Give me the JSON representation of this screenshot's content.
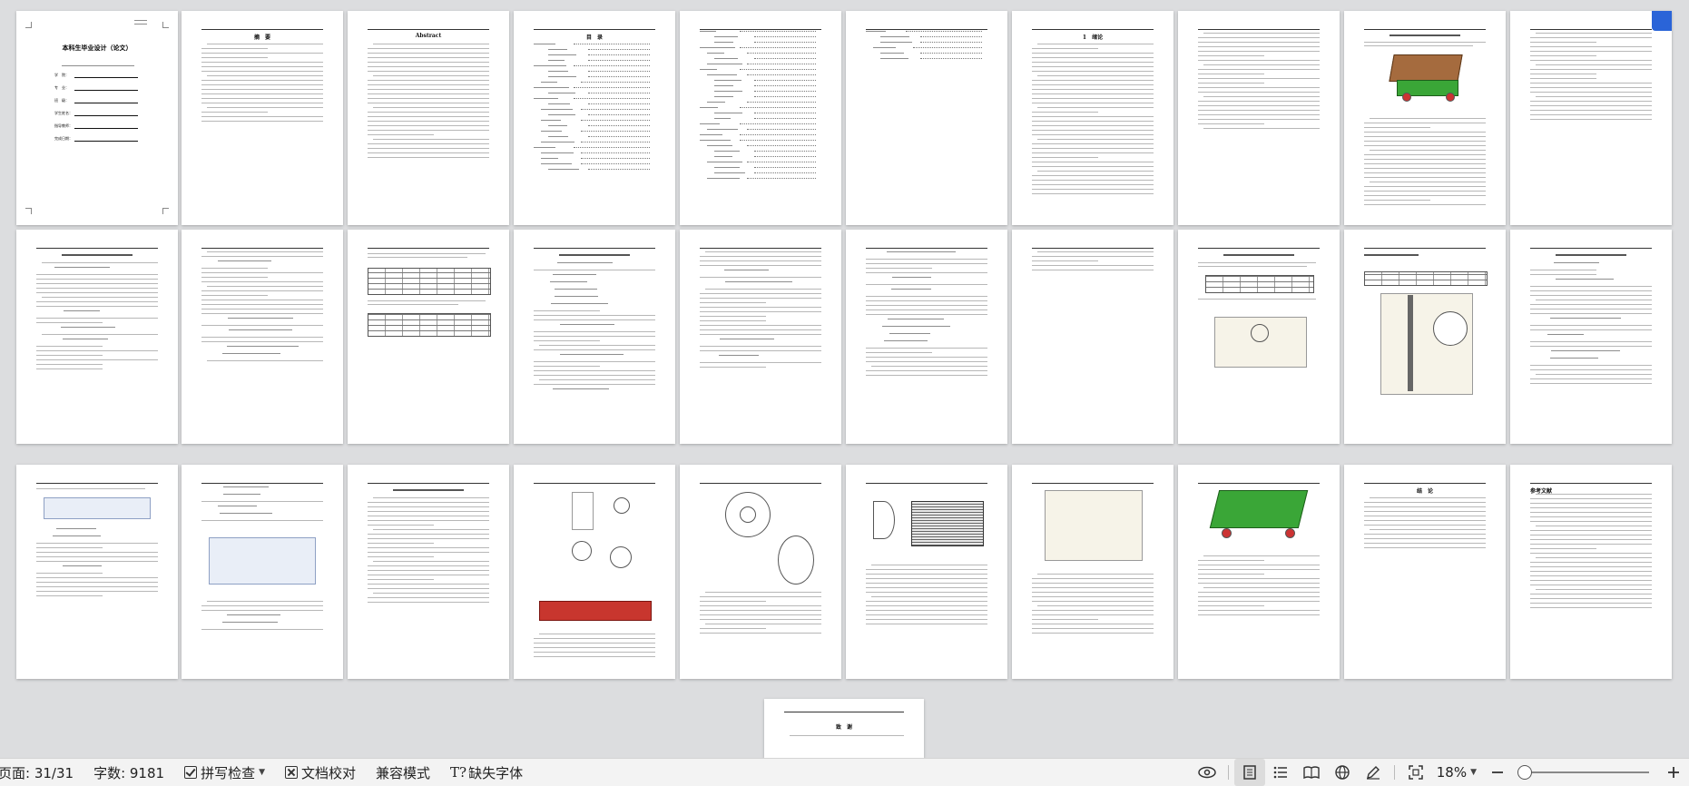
{
  "document": {
    "cover": {
      "title": "本科生毕业设计（论文）",
      "fields": [
        "学　院：",
        "专　业：",
        "班　级：",
        "学生姓名：",
        "指导教师：",
        "完成日期："
      ]
    },
    "page_titles": {
      "abstract_cn": "摘　要",
      "abstract_en": "Abstract",
      "toc": "目　录",
      "chapter1": "1　绪论",
      "conclusion": "结　论",
      "references": "参考文献",
      "thanks": "致　谢"
    },
    "page_count_visible": 31
  },
  "statusbar": {
    "page_info": "页面: 31/31",
    "word_count": "字数: 9181",
    "spell_check": "拼写检查",
    "doc_check": "文档校对",
    "compat_mode": "兼容模式",
    "missing_font": "缺失字体",
    "zoom": "18%",
    "zoom_level": 0.18,
    "icons": [
      "eye-icon",
      "page-view-icon",
      "outline-view-icon",
      "reading-view-icon",
      "web-view-icon",
      "pen-icon",
      "fit-page-icon",
      "zoom-out-icon",
      "zoom-in-icon"
    ]
  },
  "colors": {
    "workspace": "#dcdddf",
    "statusbar": "#f3f3f3",
    "bookmark": "#2a64d8"
  }
}
